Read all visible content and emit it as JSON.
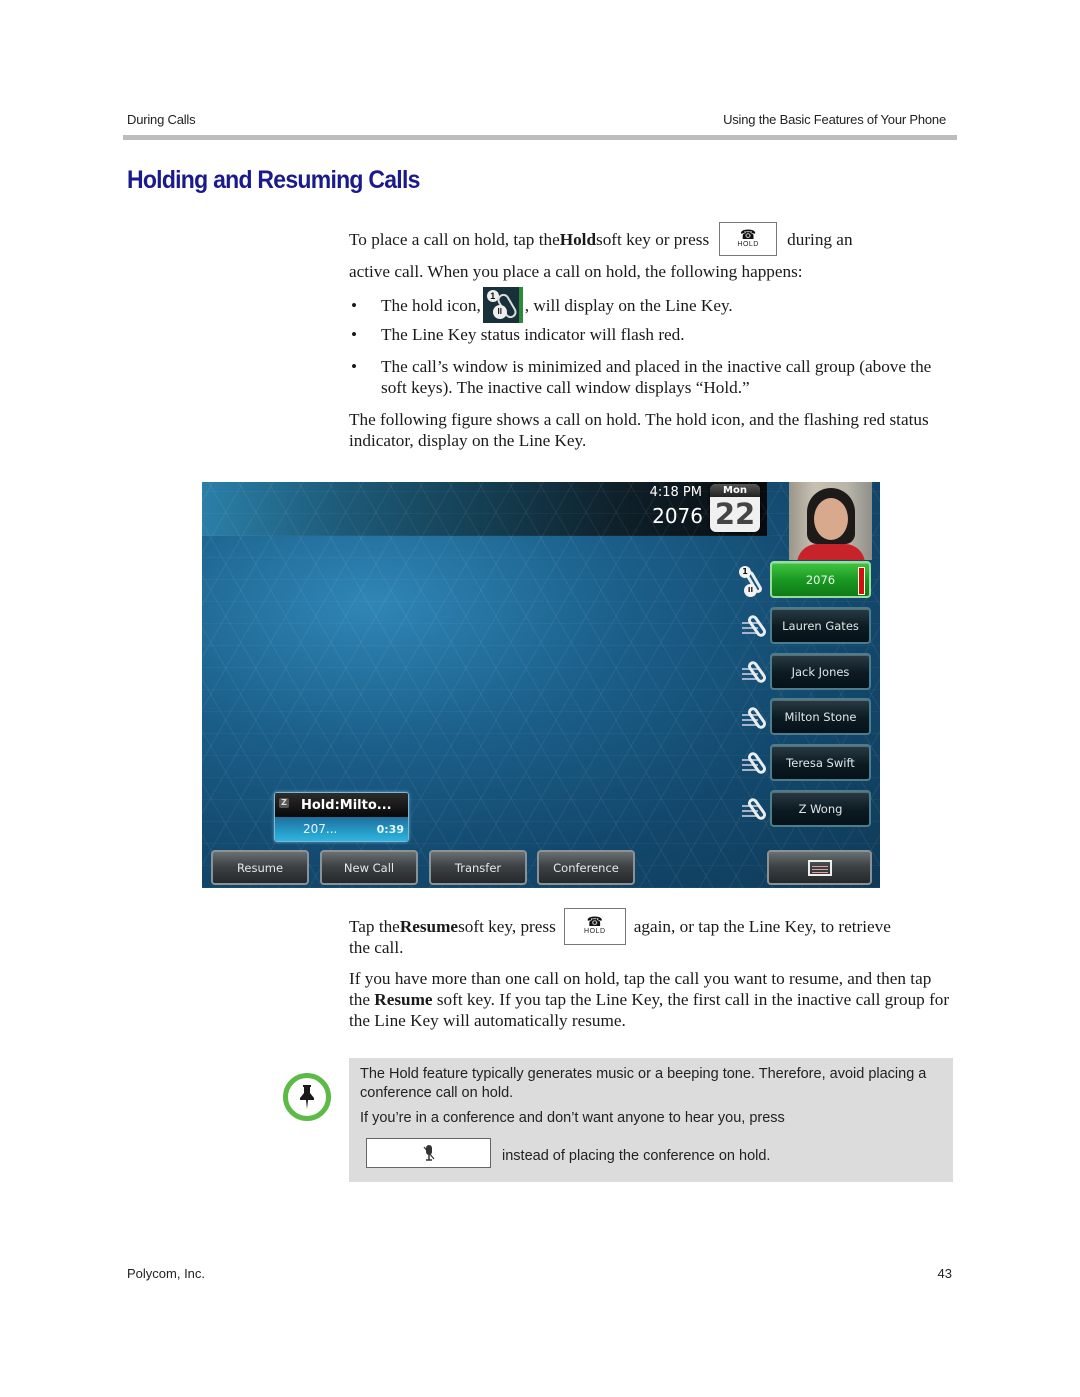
{
  "header": {
    "section": "During Calls",
    "chapter": "Using the Basic Features of Your Phone"
  },
  "title": "Holding and Resuming Calls",
  "intro": {
    "part1": "To place a call on hold, tap the ",
    "bold": "Hold",
    "part2": " soft key or press ",
    "part3": " during an",
    "line2": "active call. When you place a call on hold, the following happens:"
  },
  "hold_key": {
    "icon": "hold-icon",
    "label": "HOLD"
  },
  "bullets": [
    {
      "before": "The hold icon, ",
      "after": ", will display on the Line Key."
    },
    {
      "text": "The Line Key status indicator will flash red."
    },
    {
      "text": "The call’s window is minimized and placed in the inactive call group (above the soft keys). The inactive call window displays “Hold.”"
    }
  ],
  "figure_intro": "The following figure shows a call on hold. The hold icon, and the flashing red status indicator, display on the Line Key.",
  "phone": {
    "time": "4:18 PM",
    "extension": "2076",
    "calendar_day": "Mon",
    "calendar_date": "22",
    "hold_badge_number": "1",
    "hold_badge_symbol": "II",
    "line_keys": [
      {
        "label": "2076",
        "state": "active-hold",
        "color": "#1fa52a"
      },
      {
        "label": "Lauren Gates",
        "state": "idle"
      },
      {
        "label": "Jack Jones",
        "state": "idle"
      },
      {
        "label": "Milton Stone",
        "state": "idle"
      },
      {
        "label": "Teresa Swift",
        "state": "idle"
      },
      {
        "label": "Z Wong",
        "state": "idle"
      }
    ],
    "inactive_call": {
      "title": "Hold:Milto...",
      "number": "207...",
      "duration": "0:39"
    },
    "soft_keys": [
      "Resume",
      "New Call",
      "Transfer",
      "Conference"
    ],
    "menu_key_icon": "menu-window-icon",
    "status_indicator_color": "#d11010"
  },
  "resume": {
    "part1": "Tap the ",
    "bold": "Resume",
    "part2": " soft key, press ",
    "part3": " again, or tap the Line Key, to retrieve",
    "line2": "the call."
  },
  "multi_hold": {
    "part1": "If you have more than one call on hold, tap the call you want to resume, and then tap the ",
    "bold": "Resume",
    "part2": " soft key. If you tap the Line Key, the first call in the inactive call group for the Line Key will automatically resume."
  },
  "note": {
    "icon": "pushpin-icon",
    "accent_color": "#5cbb46",
    "text1": "The Hold feature typically generates music or a beeping tone. Therefore, avoid placing a conference call on hold.",
    "text2": "If you’re in a conference and don’t want anyone to hear you, press",
    "text3": "instead of placing the conference on hold.",
    "key_icon": "mute-microphone-icon"
  },
  "footer": {
    "company": "Polycom, Inc.",
    "page_number": "43"
  },
  "colors": {
    "title": "#1a1a8c",
    "rule": "#bdbdbd",
    "note_bg": "#dcdcdc"
  }
}
